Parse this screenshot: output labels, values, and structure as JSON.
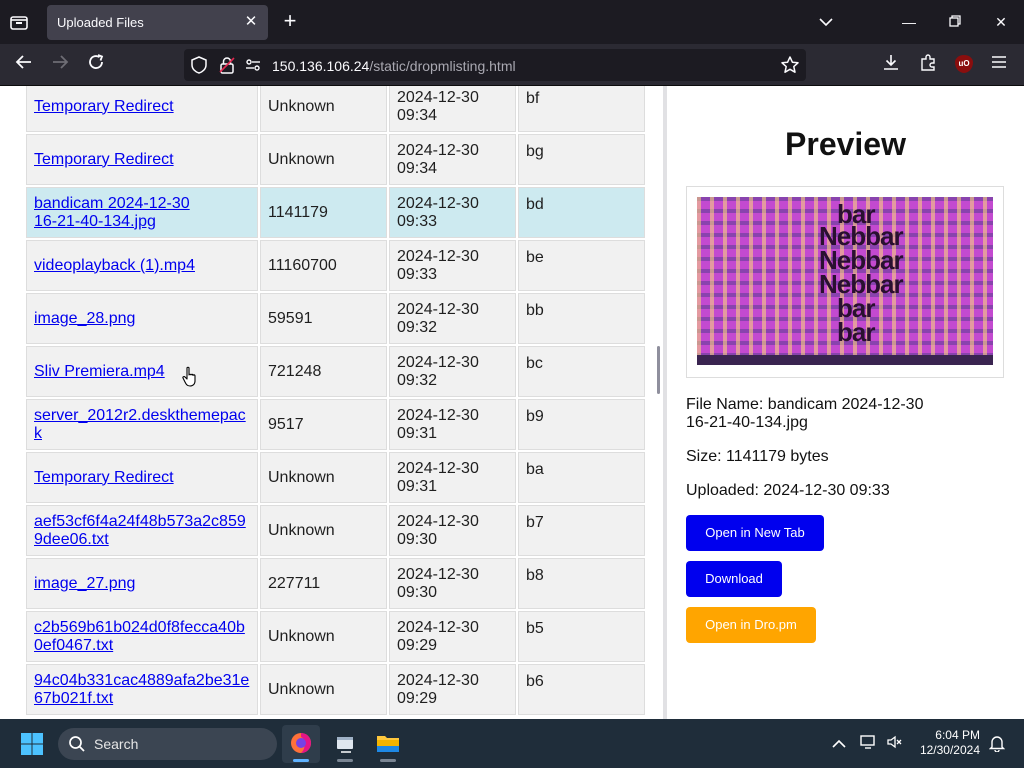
{
  "browser": {
    "tab_title": "Uploaded Files",
    "url_host": "150.136.106.24",
    "url_path": "/static/dropmlisting.html",
    "ublock_label": "uO"
  },
  "listing": {
    "rows": [
      {
        "name": "Temporary Redirect",
        "size": "Unknown",
        "date_line1": "2024-12-30",
        "date_line2": "09:34",
        "id": "bf"
      },
      {
        "name": "Temporary Redirect",
        "size": "Unknown",
        "date_line1": "2024-12-30",
        "date_line2": "09:34",
        "id": "bg"
      },
      {
        "name_line1": "bandicam 2024-12-30",
        "name_line2": "16-21-40-134.jpg",
        "size": "1141179",
        "date_line1": "2024-12-30",
        "date_line2": "09:33",
        "id": "bd"
      },
      {
        "name": "videoplayback (1).mp4",
        "size": "11160700",
        "date_line1": "2024-12-30",
        "date_line2": "09:33",
        "id": "be"
      },
      {
        "name": "image_28.png",
        "size": "59591",
        "date_line1": "2024-12-30",
        "date_line2": "09:32",
        "id": "bb"
      },
      {
        "name": "Sliv Premiera.mp4",
        "size": "721248",
        "date_line1": "2024-12-30",
        "date_line2": "09:32",
        "id": "bc"
      },
      {
        "name_line1": "server_2012r2.deskthemepac",
        "name_line2": "k",
        "size": "9517",
        "date_line1": "2024-12-30",
        "date_line2": "09:31",
        "id": "b9"
      },
      {
        "name": "Temporary Redirect",
        "size": "Unknown",
        "date_line1": "2024-12-30",
        "date_line2": "09:31",
        "id": "ba"
      },
      {
        "name_line1": "aef53cf6f4a24f48b573a2c859",
        "name_line2": "9dee06.txt",
        "size": "Unknown",
        "date_line1": "2024-12-30",
        "date_line2": "09:30",
        "id": "b7"
      },
      {
        "name": "image_27.png",
        "size": "227711",
        "date_line1": "2024-12-30",
        "date_line2": "09:30",
        "id": "b8"
      },
      {
        "name_line1": "c2b569b61b024d0f8fecca40b",
        "name_line2": "0ef0467.txt",
        "size": "Unknown",
        "date_line1": "2024-12-30",
        "date_line2": "09:29",
        "id": "b5"
      },
      {
        "name_line1": "94c04b331cac4889afa2be31e",
        "name_line2": "67b021f.txt",
        "size": "Unknown",
        "date_line1": "2024-12-30",
        "date_line2": "09:29",
        "id": "b6"
      }
    ]
  },
  "preview": {
    "title": "Preview",
    "thumb_words": [
      "bar",
      "Nebbar",
      "Nebbar",
      "Nebbar",
      "bar",
      "bar"
    ],
    "file_name_line1": "File Name: bandicam 2024-12-30",
    "file_name_line2": "16-21-40-134.jpg",
    "size": "Size: 1141179 bytes",
    "uploaded": "Uploaded: 2024-12-30 09:33",
    "btn_open_new_tab": "Open in New Tab",
    "btn_download": "Download",
    "btn_open_dro": "Open in Dro.pm"
  },
  "taskbar": {
    "search_label": "Search",
    "time": "6:04 PM",
    "date": "12/30/2024"
  },
  "colors": {
    "link": "#0000ee",
    "selected_row": "#cdeaf0",
    "button_blue": "#0000ee",
    "button_orange": "#ffa500"
  }
}
